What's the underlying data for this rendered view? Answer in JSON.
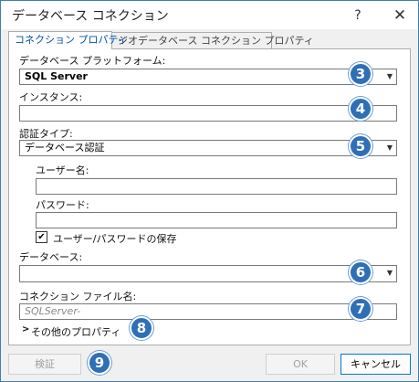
{
  "window": {
    "title": "データベース コネクション",
    "help": "?",
    "close": "✕"
  },
  "tabs": [
    {
      "label": "コネクション プロパティ",
      "active": true
    },
    {
      "label": "ジオデータベース コネクション プロパティ",
      "active": false
    }
  ],
  "form": {
    "platform_label": "データベース プラットフォーム:",
    "platform_value": "SQL Server",
    "instance_label": "インスタンス:",
    "instance_value": "",
    "auth_label": "認証タイプ:",
    "auth_value": "データベース認証",
    "username_label": "ユーザー名:",
    "username_value": "",
    "password_label": "パスワード:",
    "password_value": "",
    "save_credentials_label": "ユーザー/パスワードの保存",
    "save_credentials_checked": true,
    "database_label": "データベース:",
    "database_value": "",
    "connection_file_label": "コネクション ファイル名:",
    "connection_file_placeholder": "SQLServer-",
    "more_properties_label": "その他のプロパティ"
  },
  "badges": [
    "3",
    "4",
    "5",
    "6",
    "7",
    "8",
    "9"
  ],
  "buttons": {
    "validate": "検証",
    "ok": "OK",
    "cancel": "キャンセル"
  },
  "icons": {
    "dropdown": "chevron-down-icon",
    "expander": "chevron-right-icon",
    "check": "checkmark-icon"
  },
  "colors": {
    "badge": "#2f6fb6",
    "active_tab_text": "#0054a6",
    "border_accent": "#3c7fb1"
  }
}
